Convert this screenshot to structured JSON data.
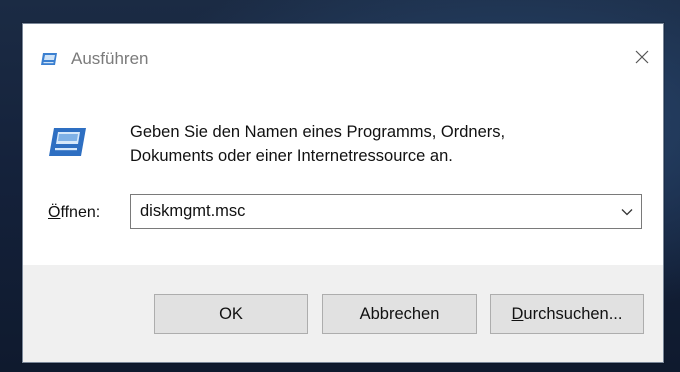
{
  "dialog": {
    "title": "Ausführen",
    "description_line1": "Geben Sie den Namen eines Programms, Ordners,",
    "description_line2": "Dokuments oder einer Internetressource an.",
    "open_label_underlined": "Ö",
    "open_label_rest": "ffnen:",
    "command_value": "diskmgmt.msc",
    "buttons": {
      "ok": "OK",
      "cancel": "Abbrechen",
      "browse_underlined": "D",
      "browse_rest": "urchsuchen..."
    }
  },
  "icons": {
    "title_icon": "run-icon",
    "big_icon": "run-icon",
    "close": "close-icon",
    "dropdown": "chevron-down-icon"
  },
  "colors": {
    "run_icon_blue": "#3a7fd0",
    "title_text": "#7b7b7b",
    "footer_bg": "#f0f0f0",
    "button_bg": "#e1e1e1"
  }
}
